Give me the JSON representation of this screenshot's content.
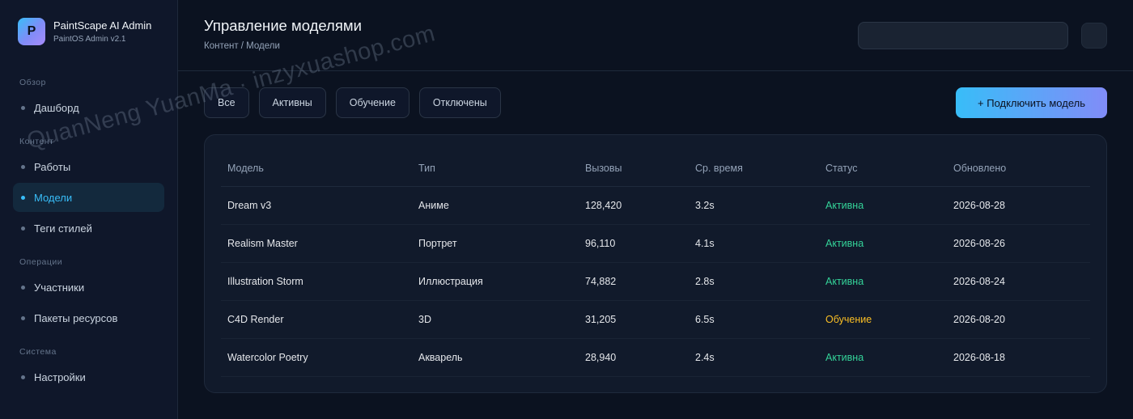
{
  "brand": {
    "logo_letter": "P",
    "title": "PaintScape AI Admin",
    "subtitle": "PaintOS Admin v2.1"
  },
  "sidebar": {
    "sections": [
      {
        "title": "Обзор",
        "items": [
          {
            "label": "Дашборд",
            "active": false
          }
        ]
      },
      {
        "title": "Контент",
        "items": [
          {
            "label": "Работы",
            "active": false
          },
          {
            "label": "Модели",
            "active": true
          },
          {
            "label": "Теги стилей",
            "active": false
          }
        ]
      },
      {
        "title": "Операции",
        "items": [
          {
            "label": "Участники",
            "active": false
          },
          {
            "label": "Пакеты ресурсов",
            "active": false
          }
        ]
      },
      {
        "title": "Система",
        "items": [
          {
            "label": "Настройки",
            "active": false
          }
        ]
      }
    ]
  },
  "header": {
    "title": "Управление моделями",
    "breadcrumb": "Контент / Модели",
    "search_value": ""
  },
  "filters": [
    "Все",
    "Активны",
    "Обучение",
    "Отключены"
  ],
  "primary_button": "+ Подключить модель",
  "table": {
    "columns": [
      "Модель",
      "Тип",
      "Вызовы",
      "Ср. время",
      "Статус",
      "Обновлено"
    ],
    "rows": [
      [
        "Dream v3",
        "Аниме",
        "128,420",
        "3.2s",
        "Активна",
        "2026-08-28"
      ],
      [
        "Realism Master",
        "Портрет",
        "96,110",
        "4.1s",
        "Активна",
        "2026-08-26"
      ],
      [
        "Illustration Storm",
        "Иллюстрация",
        "74,882",
        "2.8s",
        "Активна",
        "2026-08-24"
      ],
      [
        "C4D Render",
        "3D",
        "31,205",
        "6.5s",
        "Обучение",
        "2026-08-20"
      ],
      [
        "Watercolor Poetry",
        "Акварель",
        "28,940",
        "2.4s",
        "Активна",
        "2026-08-18"
      ]
    ]
  },
  "status_colors": {
    "Активна": "#34d399",
    "Обучение": "#fbbf24"
  },
  "watermark": "QuanNeng YuanMa · inzyxuashop.com"
}
